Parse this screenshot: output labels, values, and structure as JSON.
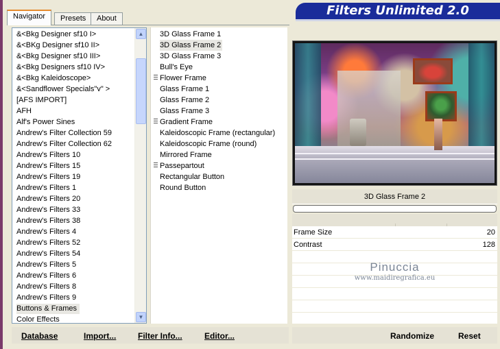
{
  "app": {
    "title": "Filters Unlimited 2.0"
  },
  "tabs": [
    {
      "label": "Navigator",
      "active": true
    },
    {
      "label": "Presets",
      "active": false
    },
    {
      "label": "About",
      "active": false
    }
  ],
  "categories": [
    "&<Bkg Designer sf10 I>",
    "&<BKg Designer sf10 II>",
    "&<Bkg Designer sf10 III>",
    "&<Bkg Designers sf10 IV>",
    "&<Bkg Kaleidoscope>",
    "&<Sandflower Specials\"v\" >",
    "[AFS IMPORT]",
    "AFH",
    "Alf's Power Sines",
    "Andrew's Filter Collection 59",
    "Andrew's Filter Collection 62",
    "Andrew's Filters 10",
    "Andrew's Filters 15",
    "Andrew's Filters 19",
    "Andrew's Filters 1",
    "Andrew's Filters 20",
    "Andrew's Filters 33",
    "Andrew's Filters 38",
    "Andrew's Filters 4",
    "Andrew's Filters 52",
    "Andrew's Filters 54",
    "Andrew's Filters 5",
    "Andrew's Filters 6",
    "Andrew's Filters 8",
    "Andrew's Filters 9",
    "Buttons & Frames",
    "Color Effects"
  ],
  "selected_category_index": 25,
  "filters": [
    {
      "label": "3D Glass Frame 1",
      "marked": false
    },
    {
      "label": "3D Glass Frame 2",
      "marked": false
    },
    {
      "label": "3D Glass Frame 3",
      "marked": false
    },
    {
      "label": "Bull's Eye",
      "marked": false
    },
    {
      "label": "Flower Frame",
      "marked": true
    },
    {
      "label": "Glass Frame 1",
      "marked": false
    },
    {
      "label": "Glass Frame 2",
      "marked": false
    },
    {
      "label": "Glass Frame 3",
      "marked": false
    },
    {
      "label": "Gradient Frame",
      "marked": true
    },
    {
      "label": "Kaleidoscopic Frame (rectangular)",
      "marked": false
    },
    {
      "label": "Kaleidoscopic Frame (round)",
      "marked": false
    },
    {
      "label": "Mirrored Frame",
      "marked": false
    },
    {
      "label": "Passepartout",
      "marked": true
    },
    {
      "label": "Rectangular Button",
      "marked": false
    },
    {
      "label": "Round Button",
      "marked": false
    }
  ],
  "selected_filter_index": 1,
  "current_filter_name": "3D Glass Frame 2",
  "progress": 0,
  "params": [
    {
      "label": "Frame Size",
      "value": "20"
    },
    {
      "label": "Contrast",
      "value": "128"
    }
  ],
  "watermark": {
    "line1": "Pinuccia",
    "line2": "www.maidiregrafica.eu"
  },
  "buttons": {
    "database": "Database",
    "import": "Import...",
    "filter_info": "Filter Info...",
    "editor": "Editor...",
    "randomize": "Randomize",
    "reset": "Reset"
  },
  "scroll_icons": {
    "up": "chevron-up-icon",
    "down": "chevron-down-icon"
  },
  "colors": {
    "banner": "#1a2c9a",
    "window": "#ece9d8",
    "tab_accent": "#e68b2c"
  }
}
